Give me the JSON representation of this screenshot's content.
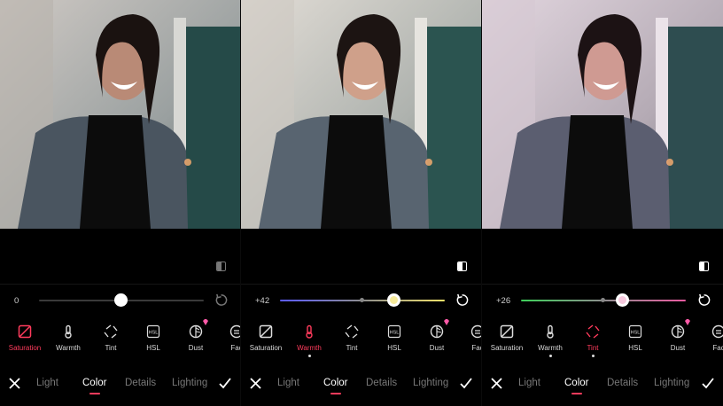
{
  "colors": {
    "accent": "#ff3b5c"
  },
  "panels": [
    {
      "slider_value": "0",
      "slider_level": 0.5,
      "track": "neutral",
      "compare_active": false,
      "selected_tool": "saturation",
      "selected_tab": "color"
    },
    {
      "slider_value": "+42",
      "slider_level": 0.71,
      "track": "warmth",
      "compare_active": true,
      "selected_tool": "warmth",
      "selected_tab": "color"
    },
    {
      "slider_value": "+26",
      "slider_level": 0.63,
      "track": "tint",
      "compare_active": true,
      "selected_tool": "tint",
      "selected_tab": "color"
    }
  ],
  "tools": {
    "saturation": "Saturation",
    "warmth": "Warmth",
    "tint": "Tint",
    "hsl": "HSL",
    "hsl_badge": "HSL",
    "dust": "Dust",
    "faces": "Fac"
  },
  "tabs": {
    "light": "Light",
    "color": "Color",
    "details": "Details",
    "lighting": "Lighting"
  },
  "icons": [
    "saturation-icon",
    "thermometer-icon",
    "tint-icon",
    "hsl-icon",
    "dust-icon",
    "faces-icon",
    "premium-gem-icon",
    "compare-icon",
    "reset-icon",
    "close-icon",
    "check-icon"
  ]
}
